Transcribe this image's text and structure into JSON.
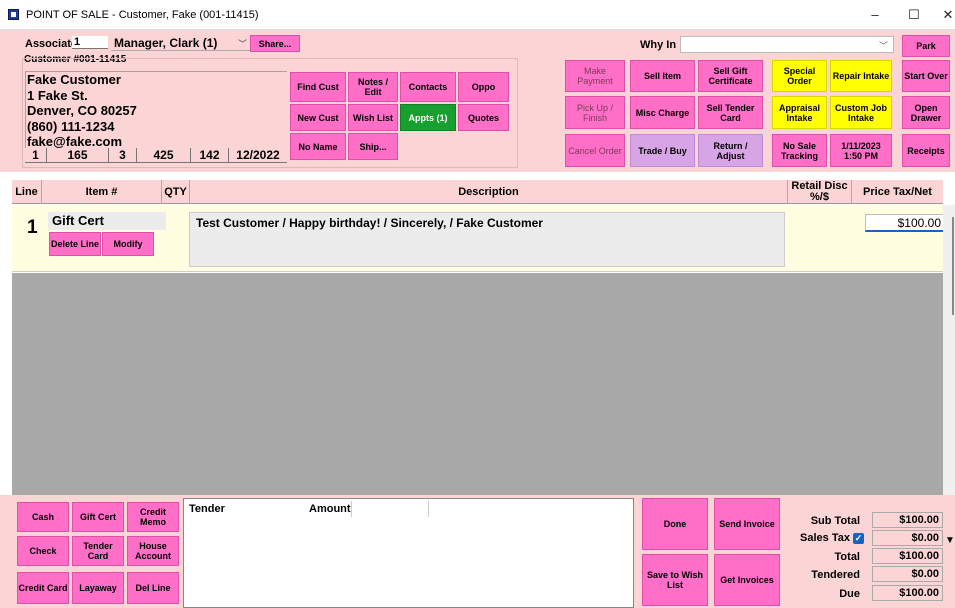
{
  "window": {
    "title": "POINT OF SALE - Customer, Fake (001-11415)",
    "minimize": "–",
    "maximize": "☐",
    "close": "✕"
  },
  "associate": {
    "label": "Associate",
    "number": "1",
    "name": "Manager, Clark (1)",
    "share_label": "Share..."
  },
  "customer": {
    "id_label": "Customer #001-11415",
    "lines": [
      "Fake Customer",
      "1 Fake St.",
      "Denver, CO 80257",
      "(860) 111-1234",
      "fake@fake.com"
    ],
    "stats": [
      "1",
      "165",
      "3",
      "425",
      "142",
      "12/2022"
    ]
  },
  "customer_buttons": {
    "find_cust": "Find Cust",
    "notes_edit": "Notes / Edit",
    "contacts": "Contacts",
    "oppo": "Oppo",
    "new_cust": "New Cust",
    "wish_list": "Wish List",
    "appts": "Appts (1)",
    "quotes": "Quotes",
    "no_name": "No Name",
    "ship": "Ship..."
  },
  "whyin": {
    "label": "Why In",
    "value": ""
  },
  "actions": {
    "make_payment": "Make Payment",
    "sell_item": "Sell Item",
    "sell_gift_certificate": "Sell Gift Certificate",
    "special_order": "Special Order",
    "repair_intake": "Repair Intake",
    "park": "Park",
    "pick_up_finish": "Pick Up / Finish",
    "misc_charge": "Misc Charge",
    "sell_tender_card": "Sell Tender Card",
    "appraisal_intake": "Appraisal Intake",
    "custom_job_intake": "Custom Job Intake",
    "start_over": "Start Over",
    "cancel_order": "Cancel Order",
    "trade_buy": "Trade / Buy",
    "return_adjust": "Return / Adjust",
    "no_sale_tracking": "No Sale Tracking",
    "datetime": "1/11/2023 1:50 PM",
    "open_drawer": "Open Drawer",
    "receipts": "Receipts"
  },
  "table": {
    "headers": {
      "line": "Line",
      "item": "Item #",
      "qty": "QTY",
      "description": "Description",
      "retail": "Retail Disc %/$",
      "price": "Price Tax/Net"
    },
    "rows": [
      {
        "line": "1",
        "item": "Gift Cert",
        "description": "Test Customer / Happy birthday! / Sincerely, / Fake Customer",
        "price": "$100.00",
        "delete_label": "Delete Line",
        "modify_label": "Modify"
      }
    ]
  },
  "payment_buttons": {
    "cash": "Cash",
    "gift_cert": "Gift Cert",
    "credit_memo": "Credit Memo",
    "check": "Check",
    "tender_card": "Tender Card",
    "house_account": "House Account",
    "credit_card": "Credit Card",
    "layaway": "Layaway",
    "del_line": "Del Line"
  },
  "tender": {
    "col_tender": "Tender",
    "col_amount": "Amount"
  },
  "bottom_actions": {
    "done": "Done",
    "send_invoice": "Send Invoice",
    "save_to_wish_list": "Save to Wish List",
    "get_invoices": "Get Invoices"
  },
  "totals": {
    "sub_total_label": "Sub Total",
    "sub_total": "$100.00",
    "sales_tax_label": "Sales Tax",
    "sales_tax": "$0.00",
    "total_label": "Total",
    "total": "$100.00",
    "tendered_label": "Tendered",
    "tendered": "$0.00",
    "due_label": "Due",
    "due": "$100.00"
  },
  "colors": {
    "panel_pink": "#fbd5d5",
    "button_pink": "#ff6fc7",
    "button_yellow": "#ffff00",
    "button_green": "#17a02f",
    "button_lilac": "#d7a4e6",
    "row_cream": "#fffee0",
    "empty_gray": "#a8a8a8"
  }
}
